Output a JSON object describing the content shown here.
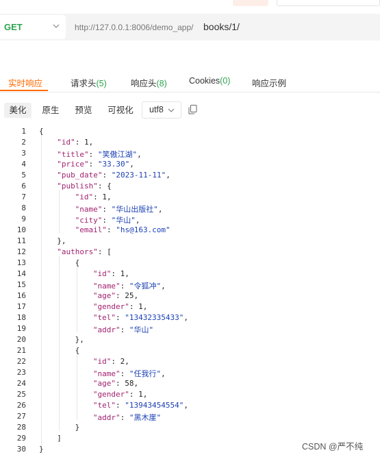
{
  "request": {
    "method": "GET",
    "url_base": "http://127.0.0.1:8006/demo_app/",
    "url_path": "books/1/"
  },
  "response_tabs": [
    {
      "label": "实时响应",
      "count": ""
    },
    {
      "label": "请求头",
      "count": "(5)"
    },
    {
      "label": "响应头",
      "count": "(8)"
    },
    {
      "label": "Cookies",
      "count": "(0)"
    },
    {
      "label": "响应示例",
      "count": ""
    }
  ],
  "format_toolbar": {
    "buttons": [
      "美化",
      "原生",
      "预览",
      "可视化"
    ],
    "encoding": "utf8"
  },
  "code_lines": [
    {
      "n": "1",
      "indent": 0,
      "parts": [
        {
          "t": "p",
          "v": "{"
        }
      ]
    },
    {
      "n": "2",
      "indent": 1,
      "parts": [
        {
          "t": "k",
          "v": "\"id\""
        },
        {
          "t": "p",
          "v": ": "
        },
        {
          "t": "n",
          "v": "1"
        },
        {
          "t": "p",
          "v": ","
        }
      ]
    },
    {
      "n": "3",
      "indent": 1,
      "parts": [
        {
          "t": "k",
          "v": "\"title\""
        },
        {
          "t": "p",
          "v": ": "
        },
        {
          "t": "s",
          "v": "\"笑傲江湖\""
        },
        {
          "t": "p",
          "v": ","
        }
      ]
    },
    {
      "n": "4",
      "indent": 1,
      "parts": [
        {
          "t": "k",
          "v": "\"price\""
        },
        {
          "t": "p",
          "v": ": "
        },
        {
          "t": "s",
          "v": "\"33.30\""
        },
        {
          "t": "p",
          "v": ","
        }
      ]
    },
    {
      "n": "5",
      "indent": 1,
      "parts": [
        {
          "t": "k",
          "v": "\"pub_date\""
        },
        {
          "t": "p",
          "v": ": "
        },
        {
          "t": "s",
          "v": "\"2023-11-11\""
        },
        {
          "t": "p",
          "v": ","
        }
      ]
    },
    {
      "n": "6",
      "indent": 1,
      "parts": [
        {
          "t": "k",
          "v": "\"publish\""
        },
        {
          "t": "p",
          "v": ": {"
        }
      ]
    },
    {
      "n": "7",
      "indent": 2,
      "parts": [
        {
          "t": "k",
          "v": "\"id\""
        },
        {
          "t": "p",
          "v": ": "
        },
        {
          "t": "n",
          "v": "1"
        },
        {
          "t": "p",
          "v": ","
        }
      ]
    },
    {
      "n": "8",
      "indent": 2,
      "parts": [
        {
          "t": "k",
          "v": "\"name\""
        },
        {
          "t": "p",
          "v": ": "
        },
        {
          "t": "s",
          "v": "\"华山出版社\""
        },
        {
          "t": "p",
          "v": ","
        }
      ]
    },
    {
      "n": "9",
      "indent": 2,
      "parts": [
        {
          "t": "k",
          "v": "\"city\""
        },
        {
          "t": "p",
          "v": ": "
        },
        {
          "t": "s",
          "v": "\"华山\""
        },
        {
          "t": "p",
          "v": ","
        }
      ]
    },
    {
      "n": "10",
      "indent": 2,
      "parts": [
        {
          "t": "k",
          "v": "\"email\""
        },
        {
          "t": "p",
          "v": ": "
        },
        {
          "t": "s",
          "v": "\"hs@163.com\""
        }
      ]
    },
    {
      "n": "11",
      "indent": 1,
      "parts": [
        {
          "t": "p",
          "v": "},"
        }
      ]
    },
    {
      "n": "12",
      "indent": 1,
      "parts": [
        {
          "t": "k",
          "v": "\"authors\""
        },
        {
          "t": "p",
          "v": ": ["
        }
      ]
    },
    {
      "n": "13",
      "indent": 2,
      "parts": [
        {
          "t": "p",
          "v": "{"
        }
      ]
    },
    {
      "n": "14",
      "indent": 3,
      "parts": [
        {
          "t": "k",
          "v": "\"id\""
        },
        {
          "t": "p",
          "v": ": "
        },
        {
          "t": "n",
          "v": "1"
        },
        {
          "t": "p",
          "v": ","
        }
      ]
    },
    {
      "n": "15",
      "indent": 3,
      "parts": [
        {
          "t": "k",
          "v": "\"name\""
        },
        {
          "t": "p",
          "v": ": "
        },
        {
          "t": "s",
          "v": "\"令狐冲\""
        },
        {
          "t": "p",
          "v": ","
        }
      ]
    },
    {
      "n": "16",
      "indent": 3,
      "parts": [
        {
          "t": "k",
          "v": "\"age\""
        },
        {
          "t": "p",
          "v": ": "
        },
        {
          "t": "n",
          "v": "25"
        },
        {
          "t": "p",
          "v": ","
        }
      ]
    },
    {
      "n": "17",
      "indent": 3,
      "parts": [
        {
          "t": "k",
          "v": "\"gender\""
        },
        {
          "t": "p",
          "v": ": "
        },
        {
          "t": "n",
          "v": "1"
        },
        {
          "t": "p",
          "v": ","
        }
      ]
    },
    {
      "n": "18",
      "indent": 3,
      "parts": [
        {
          "t": "k",
          "v": "\"tel\""
        },
        {
          "t": "p",
          "v": ": "
        },
        {
          "t": "s",
          "v": "\"13432335433\""
        },
        {
          "t": "p",
          "v": ","
        }
      ]
    },
    {
      "n": "19",
      "indent": 3,
      "parts": [
        {
          "t": "k",
          "v": "\"addr\""
        },
        {
          "t": "p",
          "v": ": "
        },
        {
          "t": "s",
          "v": "\"华山\""
        }
      ]
    },
    {
      "n": "20",
      "indent": 2,
      "parts": [
        {
          "t": "p",
          "v": "},"
        }
      ]
    },
    {
      "n": "21",
      "indent": 2,
      "parts": [
        {
          "t": "p",
          "v": "{"
        }
      ]
    },
    {
      "n": "22",
      "indent": 3,
      "parts": [
        {
          "t": "k",
          "v": "\"id\""
        },
        {
          "t": "p",
          "v": ": "
        },
        {
          "t": "n",
          "v": "2"
        },
        {
          "t": "p",
          "v": ","
        }
      ]
    },
    {
      "n": "23",
      "indent": 3,
      "parts": [
        {
          "t": "k",
          "v": "\"name\""
        },
        {
          "t": "p",
          "v": ": "
        },
        {
          "t": "s",
          "v": "\"任我行\""
        },
        {
          "t": "p",
          "v": ","
        }
      ]
    },
    {
      "n": "24",
      "indent": 3,
      "parts": [
        {
          "t": "k",
          "v": "\"age\""
        },
        {
          "t": "p",
          "v": ": "
        },
        {
          "t": "n",
          "v": "58"
        },
        {
          "t": "p",
          "v": ","
        }
      ]
    },
    {
      "n": "25",
      "indent": 3,
      "parts": [
        {
          "t": "k",
          "v": "\"gender\""
        },
        {
          "t": "p",
          "v": ": "
        },
        {
          "t": "n",
          "v": "1"
        },
        {
          "t": "p",
          "v": ","
        }
      ]
    },
    {
      "n": "26",
      "indent": 3,
      "parts": [
        {
          "t": "k",
          "v": "\"tel\""
        },
        {
          "t": "p",
          "v": ": "
        },
        {
          "t": "s",
          "v": "\"13943454554\""
        },
        {
          "t": "p",
          "v": ","
        }
      ]
    },
    {
      "n": "27",
      "indent": 3,
      "parts": [
        {
          "t": "k",
          "v": "\"addr\""
        },
        {
          "t": "p",
          "v": ": "
        },
        {
          "t": "s",
          "v": "\"黑木崖\""
        }
      ]
    },
    {
      "n": "28",
      "indent": 2,
      "parts": [
        {
          "t": "p",
          "v": "}"
        }
      ]
    },
    {
      "n": "29",
      "indent": 1,
      "parts": [
        {
          "t": "p",
          "v": "]"
        }
      ]
    },
    {
      "n": "30",
      "indent": 0,
      "parts": [
        {
          "t": "p",
          "v": "}"
        }
      ]
    }
  ],
  "watermark": "CSDN @严不纯",
  "colors": {
    "accent": "#ff6a00",
    "method_get": "#2da44e",
    "json_key": "#a1226f",
    "json_string": "#1a3fb3"
  },
  "icons": [
    "chevron-down-icon",
    "copy-icon"
  ]
}
